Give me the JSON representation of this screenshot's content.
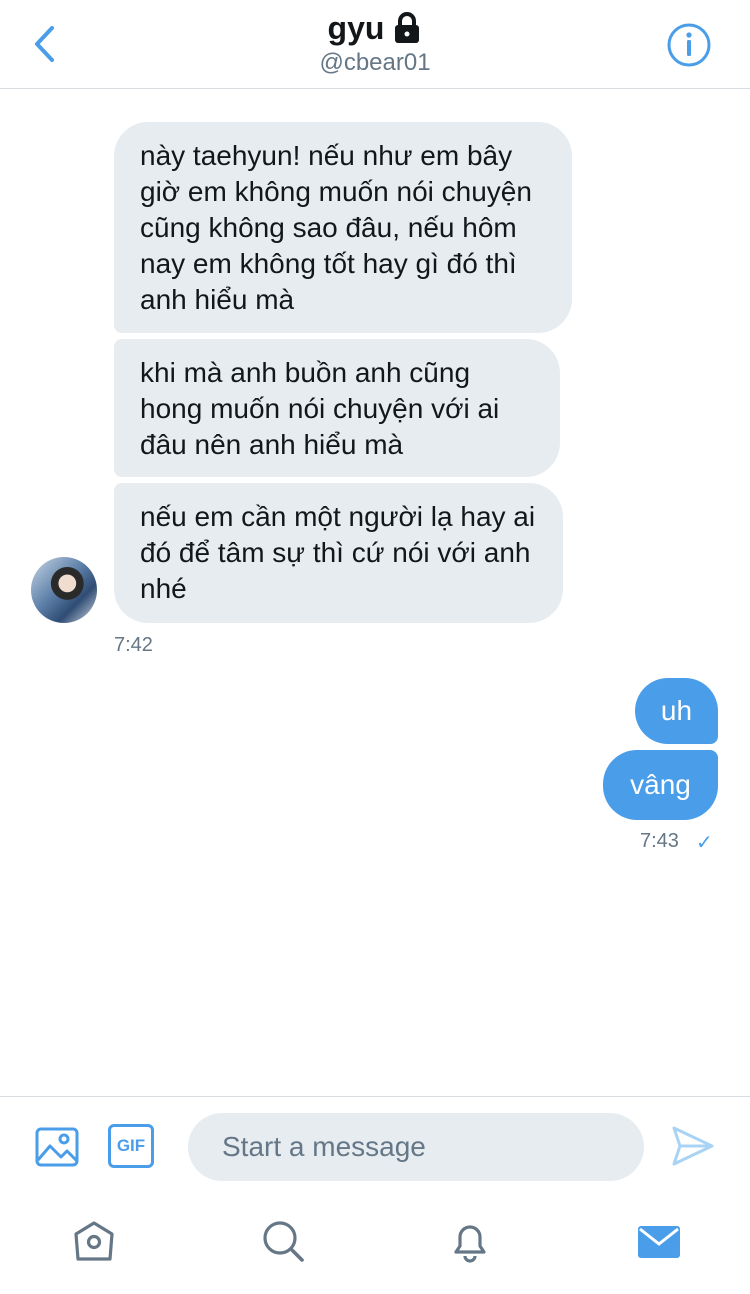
{
  "header": {
    "title": "gyu",
    "handle": "@cbear01",
    "back_icon": "chevron-left-icon",
    "lock_icon": "lock-icon",
    "info_icon": "info-icon"
  },
  "conversation": {
    "incoming": [
      {
        "text": "này taehyun! nếu như em bây giờ em không muốn nói chuyện cũng không sao đâu, nếu hôm nay em không tốt hay gì đó thì anh hiểu mà"
      },
      {
        "text": "khi mà anh buồn anh cũng hong muốn nói chuyện với ai đâu nên anh hiểu mà"
      },
      {
        "text": "nếu em cần một người lạ hay ai đó để tâm sự thì cứ nói với anh nhé"
      }
    ],
    "incoming_time": "7:42",
    "outgoing": [
      {
        "text": "uh"
      },
      {
        "text": "vâng"
      }
    ],
    "outgoing_time": "7:43",
    "read_mark": "✓"
  },
  "composer": {
    "placeholder": "Start a message",
    "gif_label": "GIF",
    "media_icon": "image-icon",
    "send_icon": "send-icon"
  },
  "tabbar": {
    "items": [
      "home-icon",
      "search-icon",
      "bell-icon",
      "mail-icon"
    ],
    "active": "mail-icon"
  },
  "colors": {
    "accent": "#4a9de8",
    "incoming_bubble": "#e6ecf0",
    "secondary_text": "#657786"
  }
}
